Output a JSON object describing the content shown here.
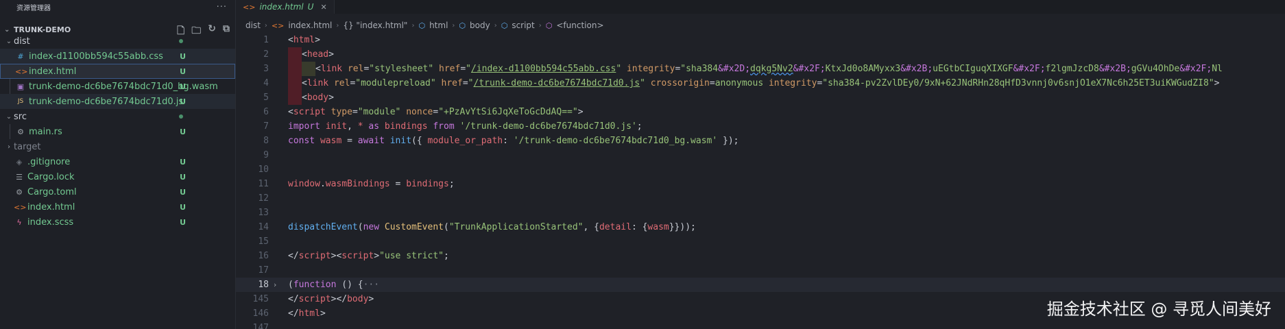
{
  "explorer": {
    "title": "资源管理器",
    "more": "···",
    "project": "TRUNK-DEMO",
    "items": [
      {
        "label": "dist",
        "kind": "folder",
        "status": "dot"
      },
      {
        "label": "index-d1100bb594c55abb.css",
        "kind": "css",
        "status": "U"
      },
      {
        "label": "index.html",
        "kind": "html",
        "status": "U"
      },
      {
        "label": "trunk-demo-dc6be7674bdc71d0_bg.wasm",
        "kind": "wasm",
        "status": "U"
      },
      {
        "label": "trunk-demo-dc6be7674bdc71d0.js",
        "kind": "js",
        "status": "U"
      },
      {
        "label": "src",
        "kind": "folder",
        "status": "dot"
      },
      {
        "label": "main.rs",
        "kind": "rs",
        "status": "U"
      },
      {
        "label": "target",
        "kind": "folder-closed",
        "status": ""
      },
      {
        "label": ".gitignore",
        "kind": "git",
        "status": "U"
      },
      {
        "label": "Cargo.lock",
        "kind": "lock",
        "status": "U"
      },
      {
        "label": "Cargo.toml",
        "kind": "toml",
        "status": "U"
      },
      {
        "label": "index.html",
        "kind": "html",
        "status": "U"
      },
      {
        "label": "index.scss",
        "kind": "scss",
        "status": "U"
      }
    ]
  },
  "tab": {
    "label": "index.html",
    "status": "U",
    "close": "✕"
  },
  "breadcrumb": [
    "dist",
    "index.html",
    "{} \"index.html\"",
    "html",
    "body",
    "script",
    "<function>"
  ],
  "editor": {
    "line_numbers": [
      "1",
      "2",
      "3",
      "4",
      "5",
      "6",
      "7",
      "8",
      "9",
      "10",
      "11",
      "12",
      "13",
      "14",
      "15",
      "16",
      "17",
      "18",
      "145",
      "146",
      "147"
    ],
    "l8": "const wasm = await init({ module_or_path: '/trunk-demo-dc6be7674bdc71d0_bg.wasm' });"
  },
  "watermark": "掘金技术社区 @ 寻觅人间美好"
}
